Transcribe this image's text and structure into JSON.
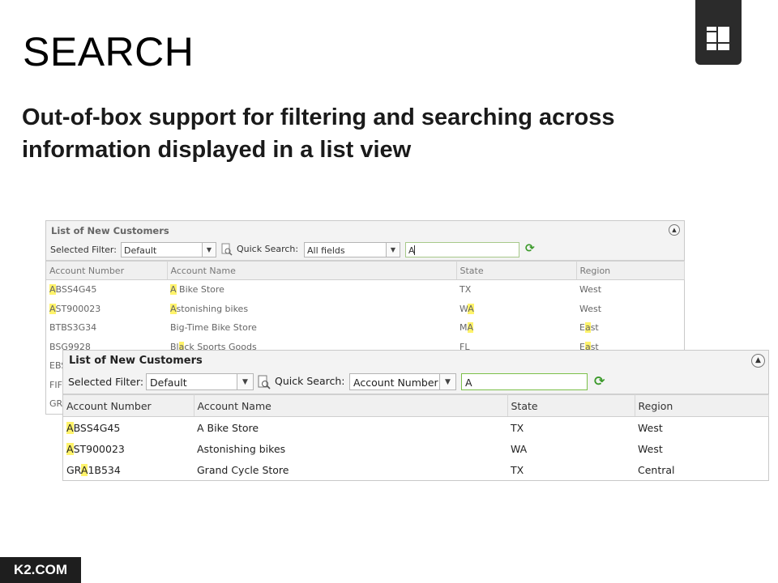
{
  "slide": {
    "title": "SEARCH",
    "subtitle": "Out-of-box support for filtering and searching across information displayed in a list view",
    "footer": "K2.COM",
    "logo_icon": "k2-grid-logo-icon"
  },
  "back_list": {
    "title": "List of New Customers",
    "filter_label": "Selected Filter:",
    "filter_value": "Default",
    "quick_search_label": "Quick Search:",
    "quick_search_field": "All fields",
    "search_value": "A",
    "columns": [
      "Account Number",
      "Account Name",
      "State",
      "Region"
    ],
    "rows": [
      [
        [
          "",
          "A",
          "BSS4G45"
        ],
        [
          "",
          "A",
          " Bike Store"
        ],
        [
          "TX",
          "",
          ""
        ],
        [
          "West",
          "",
          ""
        ]
      ],
      [
        [
          "",
          "A",
          "ST900023"
        ],
        [
          "",
          "A",
          "stonishing bikes"
        ],
        [
          "W",
          "A",
          ""
        ],
        [
          "West",
          "",
          ""
        ]
      ],
      [
        [
          "BTBS3G34",
          "",
          ""
        ],
        [
          "Big-Time Bike Store",
          "",
          ""
        ],
        [
          "M",
          "A",
          ""
        ],
        [
          "E",
          "a",
          "st"
        ]
      ],
      [
        [
          "BSG9928",
          "",
          ""
        ],
        [
          "Bl",
          "a",
          "ck Sports Goods"
        ],
        [
          "FL",
          "",
          ""
        ],
        [
          "E",
          "a",
          "st"
        ]
      ],
      [
        [
          "EBS",
          "",
          ""
        ],
        [
          "",
          "",
          ""
        ],
        [
          "",
          "",
          ""
        ],
        [
          "",
          "",
          ""
        ]
      ],
      [
        [
          "FIF",
          "",
          ""
        ],
        [
          "",
          "",
          ""
        ],
        [
          "",
          "",
          ""
        ],
        [
          "",
          "",
          ""
        ]
      ],
      [
        [
          "GR",
          "",
          ""
        ],
        [
          "",
          "",
          ""
        ],
        [
          "",
          "",
          ""
        ],
        [
          "",
          "",
          ""
        ]
      ]
    ]
  },
  "front_list": {
    "title": "List of New Customers",
    "filter_label": "Selected Filter:",
    "filter_value": "Default",
    "quick_search_label": "Quick Search:",
    "quick_search_field": "Account Number",
    "search_value": "A",
    "columns": [
      "Account Number",
      "Account Name",
      "State",
      "Region"
    ],
    "rows": [
      [
        [
          "",
          "A",
          "BSS4G45"
        ],
        [
          "A Bike Store",
          "",
          ""
        ],
        [
          "TX",
          "",
          ""
        ],
        [
          "West",
          "",
          ""
        ]
      ],
      [
        [
          "",
          "A",
          "ST900023"
        ],
        [
          "Astonishing bikes",
          "",
          ""
        ],
        [
          "WA",
          "",
          ""
        ],
        [
          "West",
          "",
          ""
        ]
      ],
      [
        [
          "GR",
          "A",
          "1B534"
        ],
        [
          "Grand Cycle Store",
          "",
          ""
        ],
        [
          "TX",
          "",
          ""
        ],
        [
          "Central",
          "",
          ""
        ]
      ]
    ]
  },
  "colors": {
    "highlight": "#fff36b",
    "refresh": "#3c9a2b",
    "active_input_border": "#7cc04a"
  }
}
